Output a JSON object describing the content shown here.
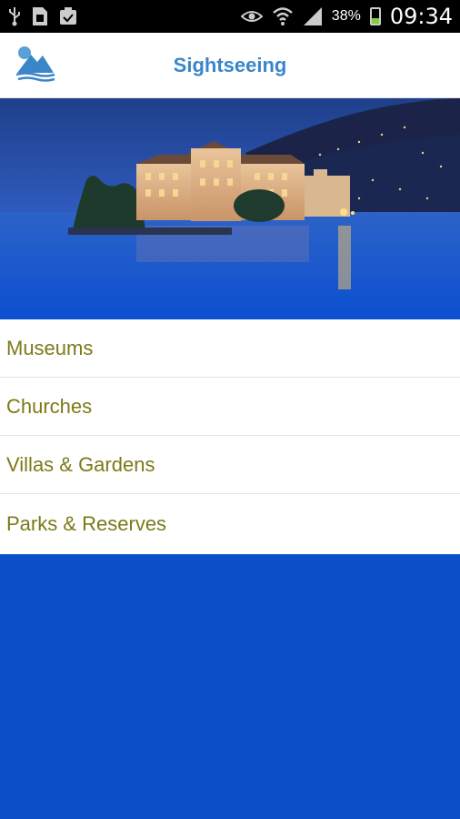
{
  "status_bar": {
    "battery_percent": "38%",
    "time": "09:34",
    "icons": [
      "usb-icon",
      "sim-icon",
      "clipboard-icon",
      "eye-icon",
      "wifi-icon",
      "signal-icon",
      "battery-charging-icon"
    ]
  },
  "app_bar": {
    "title": "Sightseeing",
    "logo_icon": "lake-mountain-logo-icon",
    "accent_color": "#3b86c9"
  },
  "hero": {
    "image": "lake-palace-night-photo"
  },
  "menu": {
    "label_color": "#7c7a17",
    "items": [
      {
        "label": "Museums"
      },
      {
        "label": "Churches"
      },
      {
        "label": "Villas & Gardens"
      },
      {
        "label": "Parks & Reserves"
      }
    ]
  },
  "background_color": "#0a4fc8"
}
